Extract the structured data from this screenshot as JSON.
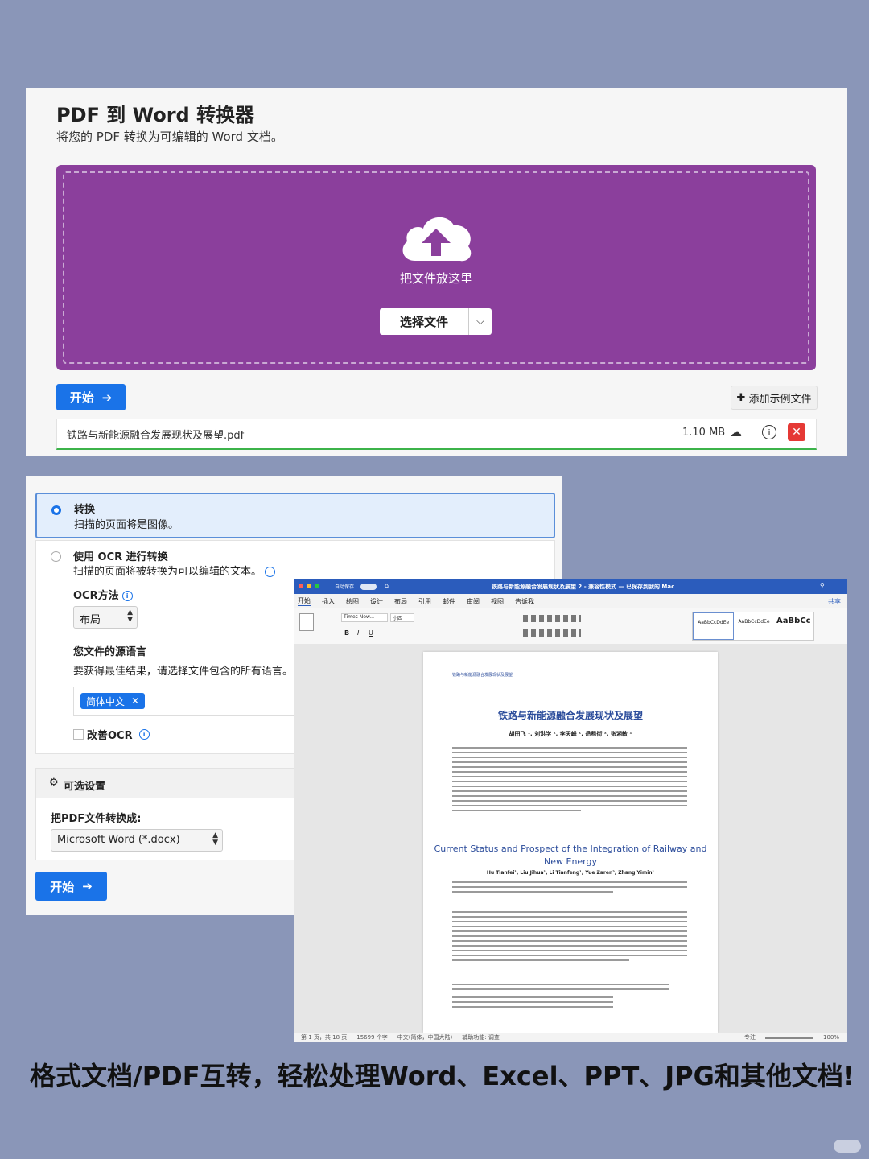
{
  "converter": {
    "title": "PDF 到 Word 转换器",
    "subtitle": "将您的 PDF 转换为可编辑的 Word 文档。",
    "drop_text": "把文件放这里",
    "choose_button": "选择文件",
    "start_button": "开始",
    "add_sample": "添加示例文件",
    "file": {
      "name": "铁路与新能源融合发展现状及展望.pdf",
      "size": "1.10 MB",
      "progress": 1.0
    }
  },
  "options": {
    "convert": {
      "title": "转换",
      "desc": "扫描的页面将是图像。"
    },
    "ocr": {
      "title": "使用 OCR 进行转换",
      "desc": "扫描的页面将被转换为可以编辑的文本。"
    },
    "ocr_method_label": "OCR方法",
    "ocr_method_value": "布局",
    "source_lang_title": "您文件的源语言",
    "source_lang_desc": "要获得最佳结果，请选择文件包含的所有语言。",
    "lang_tag": "简体中文",
    "improve_ocr": "改善OCR",
    "optional_settings": "可选设置",
    "convert_to_label": "把PDF文件转换成:",
    "format_value": "Microsoft Word (*.docx)",
    "start_button": "开始"
  },
  "word": {
    "titlebar": "铁路与新能源融合发展现状及展望 2 - 兼容性模式 — 已保存到我的 Mac",
    "autosave": "自动保存",
    "tabs": [
      "开始",
      "插入",
      "绘图",
      "设计",
      "布局",
      "引用",
      "邮件",
      "审阅",
      "视图",
      "告诉我"
    ],
    "share": "共享",
    "font_name": "Times New...",
    "font_size": "小四",
    "styles": [
      "AaBbCcDdEe",
      "AaBbCcDdEe",
      "AaBbCc"
    ],
    "doc_header": "铁路与新能源融合发展现状及展望",
    "doc_title_cn": "铁路与新能源融合发展现状及展望",
    "doc_authors_cn": "胡田飞 ¹, 刘洪学 ¹, 李天峰 ¹, 岳租街 ², 张湘敏 ¹",
    "doc_title_en": "Current Status and Prospect of the Integration of Railway and New Energy",
    "doc_authors_en": "Hu Tianfei¹, Liu Jihua¹, Li Tianfeng¹, Yue Zaren², Zhang Yimin¹",
    "status": [
      "第 1 页，共 18 页",
      "15699 个字",
      "中文(简体，中国大陆)",
      "辅助功能: 调查",
      "专注",
      "100%"
    ]
  },
  "caption": "格式文档/PDF互转，轻松处理Word、Excel、PPT、JPG和其他文档!",
  "colors": {
    "drop_zone": "#8b3f9c",
    "primary": "#1a73e8",
    "close": "#e53935",
    "progress": "#3cb34a",
    "background": "#8a96b8"
  }
}
